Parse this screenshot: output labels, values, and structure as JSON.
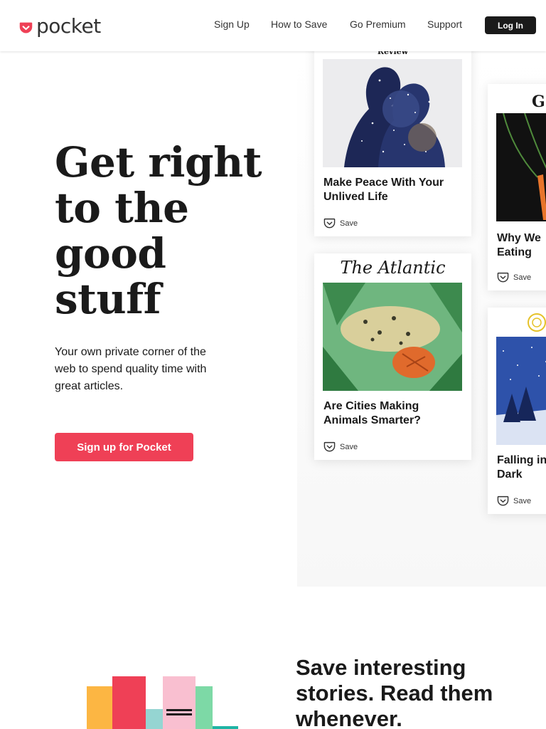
{
  "header": {
    "logo_text": "pocket",
    "nav": [
      "Sign Up",
      "How to Save",
      "Go Premium",
      "Support"
    ],
    "login_label": "Log In"
  },
  "hero": {
    "title_lines": [
      "Get right",
      "to the",
      "good",
      "stuff"
    ],
    "subtitle": "Your own private corner of the web to spend quality time with great articles.",
    "cta_label": "Sign up for Pocket"
  },
  "cards": [
    {
      "publication": "Review",
      "title": "Make Peace With Your Unlived Life",
      "save_label": "Save"
    },
    {
      "publication": "The Atlantic",
      "title": "Are Cities Making Animals Smarter?",
      "save_label": "Save"
    },
    {
      "publication": "G",
      "title": "Why We Eating",
      "save_label": "Save"
    },
    {
      "publication": "",
      "title": "Falling in Dark",
      "save_label": "Save"
    }
  ],
  "section2": {
    "heading": "Save interesting stories. Read them whenever."
  },
  "colors": {
    "brand": "#ef4056",
    "dark": "#1a1a1a"
  }
}
